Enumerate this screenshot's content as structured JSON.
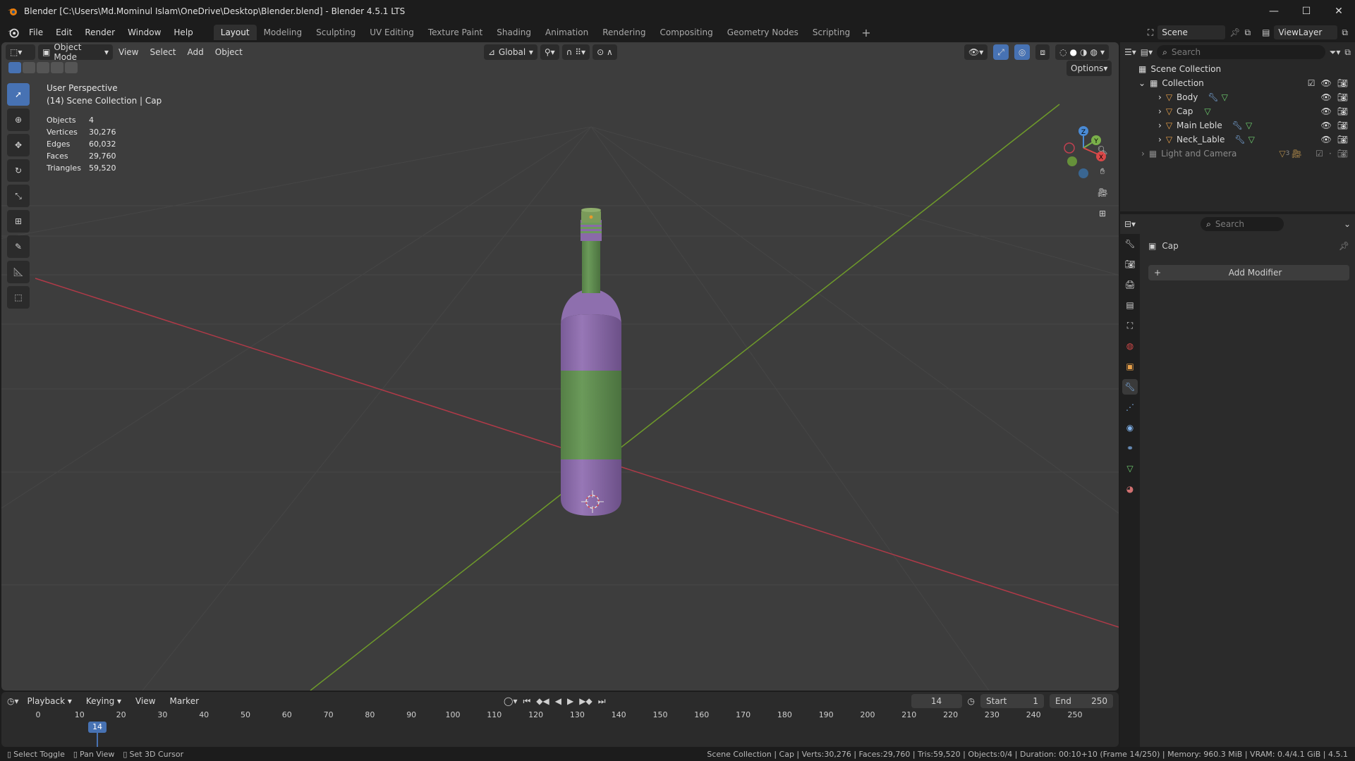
{
  "window": {
    "title": "Blender [C:\\Users\\Md.Mominul Islam\\OneDrive\\Desktop\\Blender.blend] - Blender 4.5.1 LTS",
    "controls": [
      "—",
      "☐",
      "✕"
    ]
  },
  "menu": {
    "items": [
      "File",
      "Edit",
      "Render",
      "Window",
      "Help"
    ],
    "workspaces": [
      "Layout",
      "Modeling",
      "Sculpting",
      "UV Editing",
      "Texture Paint",
      "Shading",
      "Animation",
      "Rendering",
      "Compositing",
      "Geometry Nodes",
      "Scripting"
    ],
    "active_workspace": "Layout",
    "scene": "Scene",
    "view_layer": "ViewLayer"
  },
  "viewport": {
    "mode": "Object Mode",
    "menus": [
      "View",
      "Select",
      "Add",
      "Object"
    ],
    "transform_orientation": "Global",
    "options_label": "Options",
    "overlay_title": "User Perspective",
    "overlay_subtitle": "(14) Scene Collection | Cap",
    "stats": [
      {
        "label": "Objects",
        "value": "4"
      },
      {
        "label": "Vertices",
        "value": "30,276"
      },
      {
        "label": "Edges",
        "value": "60,032"
      },
      {
        "label": "Faces",
        "value": "29,760"
      },
      {
        "label": "Triangles",
        "value": "59,520"
      }
    ],
    "gizmo_axes": [
      "Z",
      "Y",
      "X"
    ],
    "colors": {
      "background": "#3d3d3d",
      "bottle_purple": "#8a6aa8",
      "bottle_green": "#5e8a4f",
      "x_axis": "#b03a48",
      "y_axis": "#6e9a2a"
    }
  },
  "outliner": {
    "search_placeholder": "Search",
    "root": "Scene Collection",
    "collection": "Collection",
    "items": [
      {
        "name": "Body"
      },
      {
        "name": "Cap"
      },
      {
        "name": "Main Leble"
      },
      {
        "name": "Neck_Lable"
      }
    ],
    "light_camera": "Light and Camera",
    "light_camera_count": "3"
  },
  "properties": {
    "search_placeholder": "Search",
    "object_name": "Cap",
    "add_modifier": "Add Modifier"
  },
  "timeline": {
    "menus": [
      "Playback",
      "Keying",
      "View",
      "Marker"
    ],
    "current_frame": "14",
    "start_label": "Start",
    "start_value": "1",
    "end_label": "End",
    "end_value": "250",
    "ticks": [
      "0",
      "10",
      "20",
      "30",
      "40",
      "50",
      "60",
      "70",
      "80",
      "90",
      "100",
      "110",
      "120",
      "130",
      "140",
      "150",
      "160",
      "170",
      "180",
      "190",
      "200",
      "210",
      "220",
      "230",
      "240",
      "250"
    ]
  },
  "statusbar": {
    "left": [
      "Select Toggle",
      "Pan View",
      "Set 3D Cursor"
    ],
    "right": "Scene Collection | Cap | Verts:30,276 | Faces:29,760 | Tris:59,520 | Objects:0/4 | Duration: 00:10+10 (Frame 14/250) | Memory: 960.3 MiB | VRAM: 0.4/4.1 GiB | 4.5.1"
  }
}
